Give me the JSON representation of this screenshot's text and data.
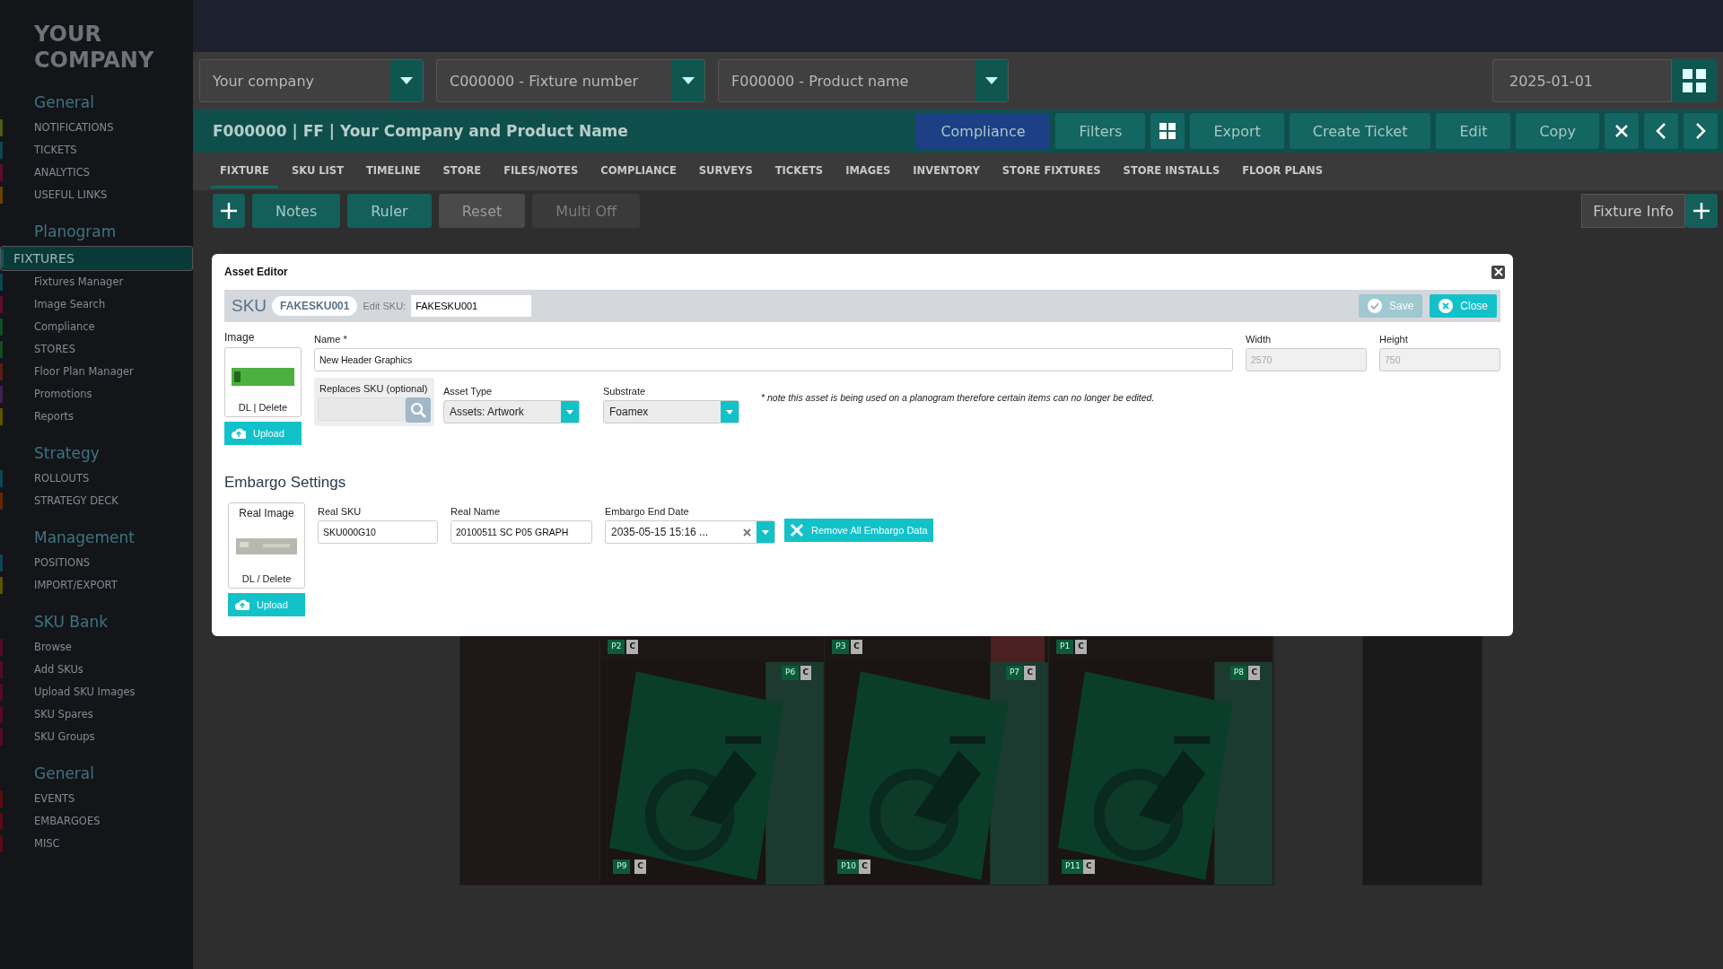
{
  "company_logo": "YOUR COMPANY",
  "sidebar": [
    {
      "heading": "General",
      "items": [
        {
          "label": "NOTIFICATIONS",
          "color": "#4a5a14",
          "selected": false
        },
        {
          "label": "TICKETS",
          "color": "#0e4656",
          "selected": false
        },
        {
          "label": "ANALYTICS",
          "color": "#5c0c2c",
          "selected": false
        },
        {
          "label": "USEFUL LINKS",
          "color": "#6a4200",
          "selected": false
        }
      ]
    },
    {
      "heading": "Planogram",
      "items": [
        {
          "label": "FIXTURES",
          "color": "#0a5a54",
          "selected": true
        },
        {
          "label": "Fixtures Manager",
          "color": "#0e4656",
          "selected": false
        },
        {
          "label": "Image Search",
          "color": "#5c0c2c",
          "selected": false
        },
        {
          "label": "Compliance",
          "color": "#164c24",
          "selected": false
        },
        {
          "label": "STORES",
          "color": "#164c24",
          "selected": false
        },
        {
          "label": "Floor Plan Manager",
          "color": "#5c1c14",
          "selected": false
        },
        {
          "label": "Promotions",
          "color": "#441e54",
          "selected": false
        },
        {
          "label": "Reports",
          "color": "#5e5400",
          "selected": false
        }
      ]
    },
    {
      "heading": "Strategy",
      "items": [
        {
          "label": "ROLLOUTS",
          "color": "#0e4656",
          "selected": false
        },
        {
          "label": "STRATEGY DECK",
          "color": "#642800",
          "selected": false
        }
      ]
    },
    {
      "heading": "Management",
      "items": [
        {
          "label": "POSITIONS",
          "color": "#0e4656",
          "selected": false
        },
        {
          "label": "IMPORT/EXPORT",
          "color": "#5e5400",
          "selected": false
        }
      ]
    },
    {
      "heading": "SKU Bank",
      "items": [
        {
          "label": "Browse",
          "color": "#540a24",
          "selected": false
        },
        {
          "label": "Add SKUs",
          "color": "#540a24",
          "selected": false
        },
        {
          "label": "Upload SKU Images",
          "color": "#540a24",
          "selected": false
        },
        {
          "label": "SKU Spares",
          "color": "#540a24",
          "selected": false
        },
        {
          "label": "SKU Groups",
          "color": "#540a24",
          "selected": false
        }
      ]
    },
    {
      "heading": "General",
      "items": [
        {
          "label": "EVENTS",
          "color": "#5a0a14",
          "selected": false
        },
        {
          "label": "EMBARGOES",
          "color": "#5a0a14",
          "selected": false
        },
        {
          "label": "MISC",
          "color": "#5a0a14",
          "selected": false
        }
      ]
    }
  ],
  "filters": {
    "company": "Your company",
    "fixture": "C000000 - Fixture number",
    "product": "F000000 - Product name",
    "date": "2025-01-01"
  },
  "title_bar": {
    "title": "F000000 | FF | Your Company and Product Name",
    "buttons": [
      {
        "kind": "primary",
        "label": "Compliance"
      },
      {
        "kind": "text",
        "label": "Filters"
      },
      {
        "kind": "grid"
      },
      {
        "kind": "text",
        "label": "Export"
      },
      {
        "kind": "text",
        "label": "Create Ticket"
      },
      {
        "kind": "text",
        "label": "Edit"
      },
      {
        "kind": "text",
        "label": "Copy"
      },
      {
        "kind": "close"
      },
      {
        "kind": "prev"
      },
      {
        "kind": "next"
      }
    ]
  },
  "tabs": [
    {
      "label": "FIXTURE",
      "selected": true
    },
    {
      "label": "SKU LIST",
      "selected": false
    },
    {
      "label": "TIMELINE",
      "selected": false
    },
    {
      "label": "STORE",
      "selected": false
    },
    {
      "label": "FILES/NOTES",
      "selected": false
    },
    {
      "label": "COMPLIANCE",
      "selected": false
    },
    {
      "label": "SURVEYS",
      "selected": false
    },
    {
      "label": "TICKETS",
      "selected": false
    },
    {
      "label": "IMAGES",
      "selected": false
    },
    {
      "label": "INVENTORY",
      "selected": false
    },
    {
      "label": "STORE FIXTURES",
      "selected": false
    },
    {
      "label": "STORE INSTALLS",
      "selected": false
    },
    {
      "label": "FLOOR PLANS",
      "selected": false
    }
  ],
  "toolbar": {
    "buttons": [
      {
        "kind": "add",
        "disabled": false
      },
      {
        "kind": "text",
        "label": "Notes",
        "disabled": false
      },
      {
        "kind": "text",
        "label": "Ruler",
        "disabled": false
      },
      {
        "kind": "text",
        "label": "Reset",
        "disabled": true
      },
      {
        "kind": "faint",
        "label": "Multi Off",
        "disabled": true
      }
    ],
    "fixture_info": "Fixture Info"
  },
  "planogram": {
    "bays": [
      {
        "top_tag": {
          "label": "P2",
          "badge": "C"
        },
        "side_tag": {
          "label": "P6",
          "badge": "C"
        },
        "bottom_tag": {
          "label": "P9",
          "badge": "C"
        },
        "flagged": false
      },
      {
        "top_tag": {
          "label": "P3",
          "badge": "C"
        },
        "side_tag": {
          "label": "P7",
          "badge": "C"
        },
        "bottom_tag": {
          "label": "P10",
          "badge": "C"
        },
        "flagged": true
      },
      {
        "top_tag": {
          "label": "P1",
          "badge": "C"
        },
        "side_tag": {
          "label": "P8",
          "badge": "C"
        },
        "bottom_tag": {
          "label": "P11",
          "badge": "C"
        },
        "flagged": false
      }
    ]
  },
  "asset_editor": {
    "title": "Asset Editor",
    "sku_label": "SKU",
    "sku_badge": "FAKESKU001",
    "edit_sku_label": "Edit SKU:",
    "edit_sku_value": "FAKESKU001",
    "save": {
      "label": "Save",
      "disabled": true
    },
    "close": {
      "label": "Close",
      "disabled": false
    },
    "image_label": "Image",
    "image_links": "DL | Delete",
    "upload": "Upload",
    "name_label": "Name *",
    "name_value": "New Header Graphics",
    "width_label": "Width",
    "width_value": "2570",
    "width_disabled": true,
    "height_label": "Height",
    "height_value": "750",
    "height_disabled": true,
    "replaces_label": "Replaces SKU (optional)",
    "asset_type_label": "Asset Type",
    "asset_type_value": "Assets: Artwork",
    "substrate_label": "Substrate",
    "substrate_value": "Foamex",
    "note": "* note this asset is being used on a planogram therefore certain items can no longer be edited.",
    "embargo": {
      "heading": "Embargo Settings",
      "real_image_label": "Real Image",
      "image_links": "DL / Delete",
      "upload": "Upload",
      "real_sku_label": "Real SKU",
      "real_sku_value": "SKU000G10",
      "real_name_label": "Real Name",
      "real_name_value": "20100511 SC P05 GRAPH",
      "end_date_label": "Embargo End Date",
      "end_date_value": "2035-05-15 15:16 ...",
      "remove_button": "Remove All Embargo Data"
    }
  }
}
